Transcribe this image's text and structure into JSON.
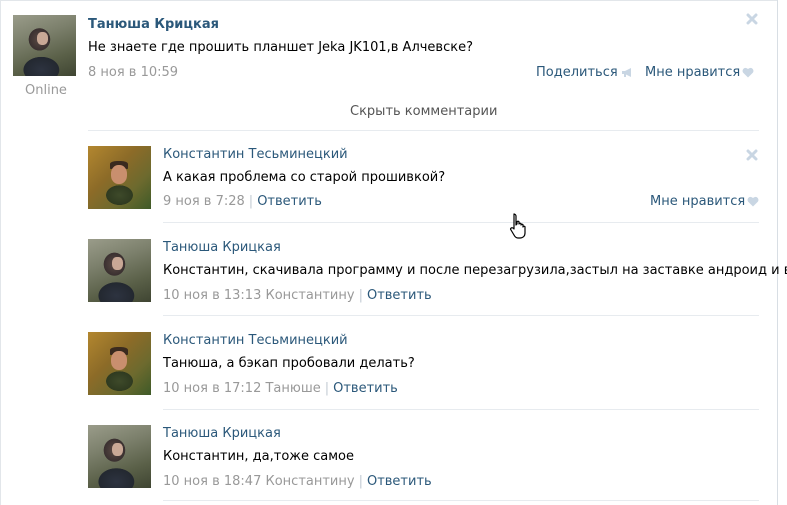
{
  "post": {
    "author": "Танюша Крицкая",
    "status": "Online",
    "text": "Не знаете где прошить планшет Jeka JK101,в Алчевске?",
    "time": "8 ноя в 10:59",
    "share_label": "Поделиться",
    "like_label": "Мне нравится"
  },
  "hide_comments_label": "Скрыть комментарии",
  "comments": [
    {
      "author": "Константин Тесьминецкий",
      "text": "А какая проблема со старой прошивкой?",
      "time": "9 ноя в 7:28",
      "reply_to": "",
      "reply_label": "Ответить",
      "like_label": "Мне нравится"
    },
    {
      "author": "Танюша Крицкая",
      "text": "Константин, скачивала программу и после перезагрузила,застыл на заставке андроид и всё.",
      "time": "10 ноя в 13:13",
      "reply_to": "Константину",
      "reply_label": "Ответить"
    },
    {
      "author": "Константин Тесьминецкий",
      "text": "Танюша, а бэкап пробовали делать?",
      "time": "10 ноя в 17:12",
      "reply_to": "Танюше",
      "reply_label": "Ответить"
    },
    {
      "author": "Танюша Крицкая",
      "text": "Константин, да,тоже самое",
      "time": "10 ноя в 18:47",
      "reply_to": "Константину",
      "reply_label": "Ответить"
    }
  ],
  "colors": {
    "link": "#2b587a",
    "meta": "#999999",
    "divider": "#e7ebef",
    "icon": "#c9d6e3"
  },
  "icons": [
    "close-icon",
    "megaphone-icon",
    "heart-icon",
    "hand-cursor-icon"
  ]
}
